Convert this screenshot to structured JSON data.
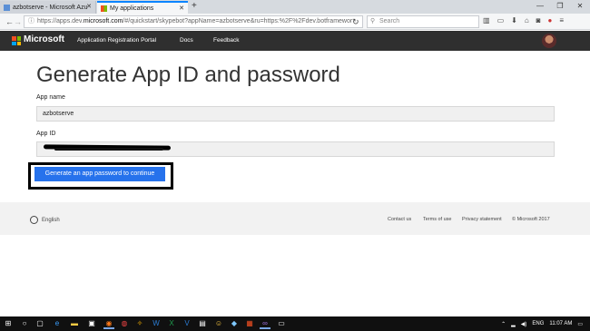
{
  "browser": {
    "tabs": [
      {
        "title": "azbotserve - Microsoft Azu",
        "active": false
      },
      {
        "title": "My applications",
        "active": true
      }
    ],
    "url_prefix": "https://apps.dev.",
    "url_domain": "microsoft.com",
    "url_rest": "/#/quickstart/skypebot?appName=azbotserve&ru=https:%2F%2Fdev.botframewor",
    "search_placeholder": "Search",
    "icons": {
      "back": "back-arrow-icon",
      "reload": "reload-icon",
      "search": "search-icon",
      "library": "library-icon",
      "reader": "reader-icon",
      "download": "download-icon",
      "home": "home-icon",
      "pocket": "pocket-icon",
      "menu": "hamburger-icon"
    }
  },
  "header": {
    "brand": "Microsoft",
    "nav": [
      "Application Registration Portal",
      "Docs",
      "Feedback"
    ]
  },
  "main": {
    "title": "Generate App ID and password",
    "app_name_label": "App name",
    "app_name_value": "azbotserve",
    "app_id_label": "App ID",
    "app_id_value": "",
    "generate_button": "Generate an app password to continue"
  },
  "footer": {
    "language": "English",
    "links": [
      "Contact us",
      "Terms of use",
      "Privacy statement",
      "© Microsoft 2017"
    ]
  },
  "taskbar": {
    "language": "ENG",
    "time": "11:07 AM"
  },
  "colors": {
    "accent_button": "#2672ec",
    "header_bg": "#2f2f2f",
    "tab_active_border": "#0a84ff"
  }
}
